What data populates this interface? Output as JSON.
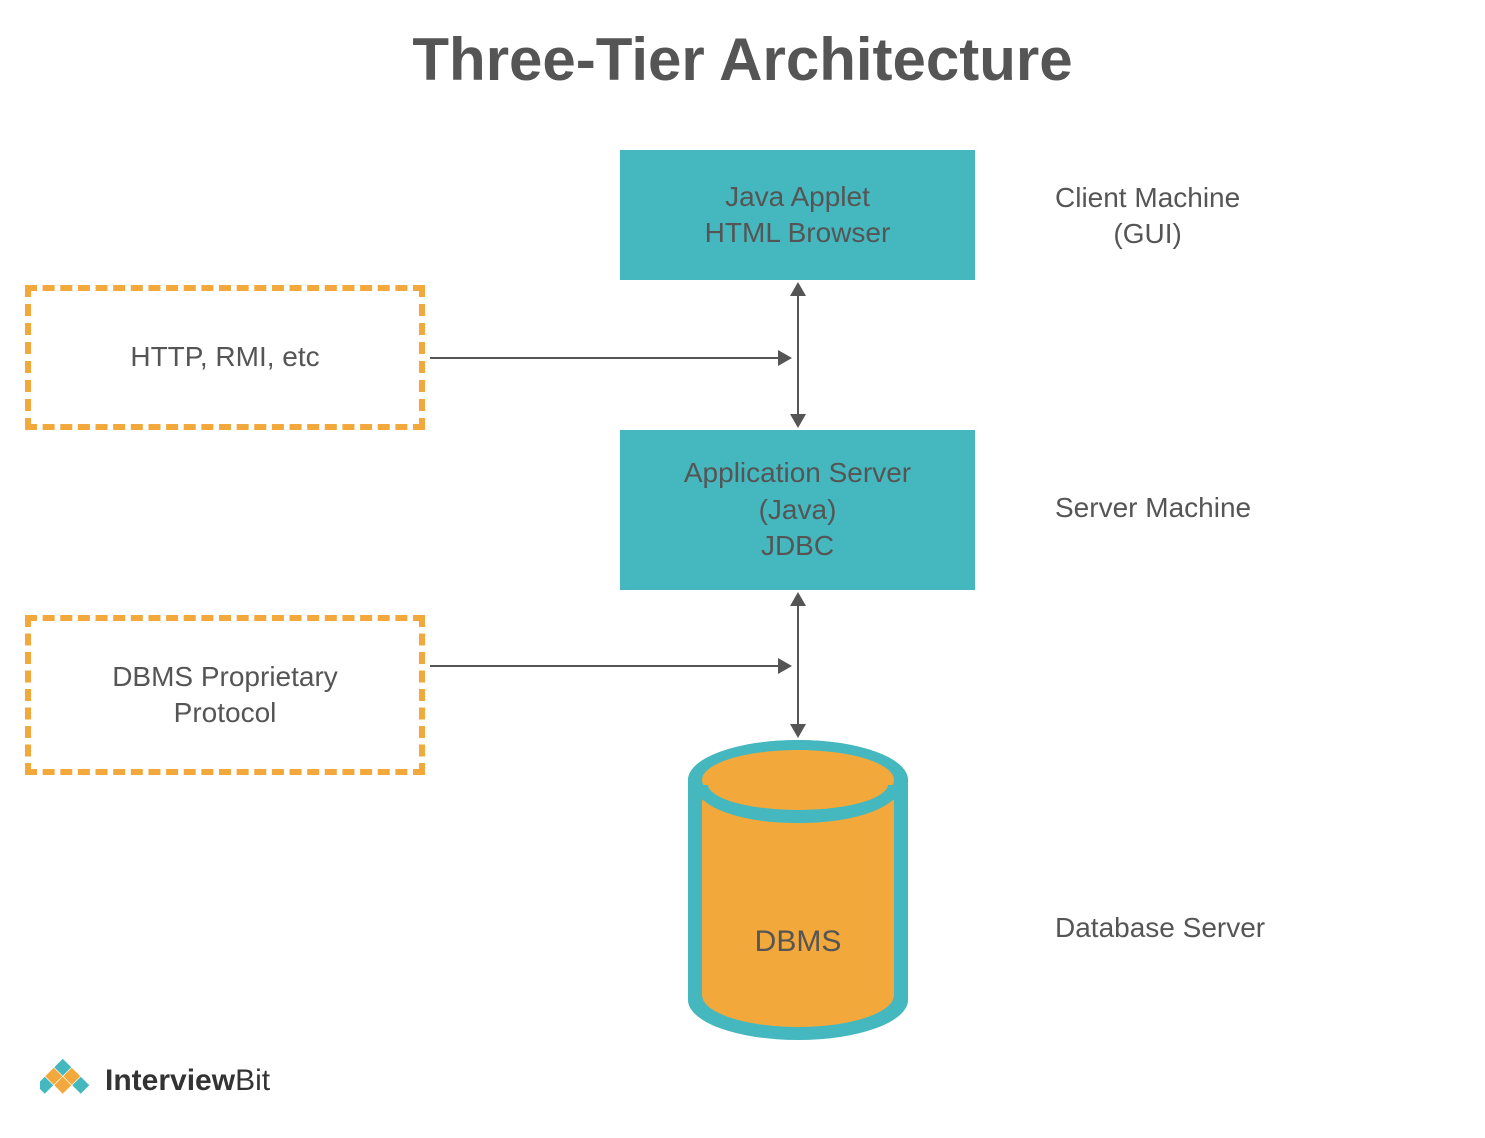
{
  "title": "Three-Tier Architecture",
  "tier1": {
    "box_line1": "Java Applet",
    "box_line2": "HTML Browser",
    "label_line1": "Client Machine",
    "label_line2": "(GUI)"
  },
  "tier2": {
    "box_line1": "Application Server",
    "box_line2": "(Java)",
    "box_line3": "JDBC",
    "label": "Server Machine"
  },
  "tier3": {
    "db_label": "DBMS",
    "label": "Database Server"
  },
  "protocol1": {
    "text": "HTTP, RMI, etc"
  },
  "protocol2": {
    "line1": "DBMS Proprietary",
    "line2": "Protocol"
  },
  "logo": {
    "bold": "Interview",
    "light": "Bit"
  }
}
